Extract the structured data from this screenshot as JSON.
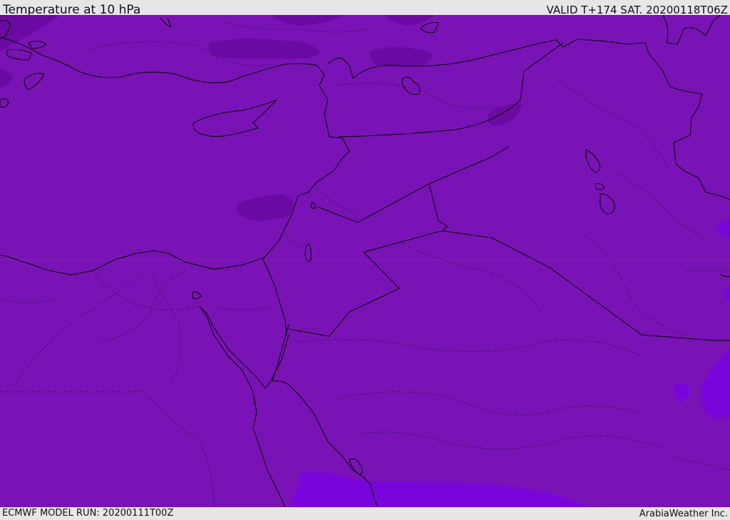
{
  "header": {
    "title": "Temperature at 10 hPa",
    "valid": "VALID T+174 SAT. 20200118T06Z"
  },
  "footer": {
    "model_run": "ECMWF MODEL RUN: 20200111T00Z",
    "credit": "ArabiaWeather Inc."
  },
  "colors": {
    "field_base": "#7a13b5",
    "field_cold_patch": "#6a0aa3",
    "field_warm_patch": "#7a05da",
    "coastline": "#000000",
    "border_dotted": "#2a0a3a"
  }
}
